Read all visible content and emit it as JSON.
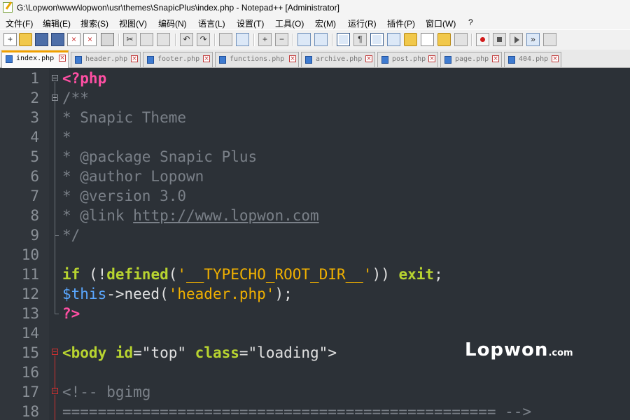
{
  "window": {
    "title": "G:\\Lopwon\\www\\lopwon\\usr\\themes\\SnapicPlus\\index.php - Notepad++ [Administrator]"
  },
  "menu": {
    "items": [
      {
        "label": "文件(F)"
      },
      {
        "label": "编辑(E)"
      },
      {
        "label": "搜索(S)"
      },
      {
        "label": "视图(V)"
      },
      {
        "label": "编码(N)"
      },
      {
        "label": "语言(L)"
      },
      {
        "label": "设置(T)"
      },
      {
        "label": "工具(O)"
      },
      {
        "label": "宏(M)"
      },
      {
        "label": "运行(R)"
      },
      {
        "label": "插件(P)"
      },
      {
        "label": "窗口(W)"
      },
      {
        "label": "?"
      }
    ]
  },
  "toolbar": {
    "icons": [
      "new-file-icon",
      "open-file-icon",
      "save-icon",
      "save-all-icon",
      "close-icon",
      "close-all-icon",
      "print-icon",
      "cut-icon",
      "copy-icon",
      "paste-icon",
      "undo-icon",
      "redo-icon",
      "find-icon",
      "replace-icon",
      "zoom-in-icon",
      "zoom-out-icon",
      "sync-v-icon",
      "sync-h-icon",
      "word-wrap-icon",
      "show-all-chars-icon",
      "indent-guide-icon",
      "udl-icon",
      "doc-map-icon",
      "function-list-icon",
      "folder-workspace-icon",
      "monitor-icon",
      "record-macro-icon",
      "stop-macro-icon",
      "play-macro-icon",
      "run-macro-icon",
      "save-macro-icon"
    ]
  },
  "tabs": [
    {
      "label": "index.php",
      "active": true
    },
    {
      "label": "header.php",
      "active": false
    },
    {
      "label": "footer.php",
      "active": false
    },
    {
      "label": "functions.php",
      "active": false
    },
    {
      "label": "archive.php",
      "active": false
    },
    {
      "label": "post.php",
      "active": false
    },
    {
      "label": "page.php",
      "active": false
    },
    {
      "label": "404.php",
      "active": false
    }
  ],
  "editor": {
    "lines": [
      {
        "n": "1",
        "tokens": [
          {
            "t": "<?php",
            "c": "c-tag"
          }
        ]
      },
      {
        "n": "2",
        "tokens": [
          {
            "t": "/**",
            "c": "c-comment"
          }
        ]
      },
      {
        "n": "3",
        "tokens": [
          {
            "t": "* Snapic Theme",
            "c": "c-comment"
          }
        ]
      },
      {
        "n": "4",
        "tokens": [
          {
            "t": "*",
            "c": "c-comment"
          }
        ]
      },
      {
        "n": "5",
        "tokens": [
          {
            "t": "* @package Snapic Plus",
            "c": "c-comment"
          }
        ]
      },
      {
        "n": "6",
        "tokens": [
          {
            "t": "* @author Lopown",
            "c": "c-comment"
          }
        ]
      },
      {
        "n": "7",
        "tokens": [
          {
            "t": "* @version 3.0",
            "c": "c-comment"
          }
        ]
      },
      {
        "n": "8",
        "tokens": [
          {
            "t": "* @link ",
            "c": "c-comment"
          },
          {
            "t": "http://www.lopwon.com",
            "c": "c-link"
          }
        ]
      },
      {
        "n": "9",
        "tokens": [
          {
            "t": "*/",
            "c": "c-comment"
          }
        ]
      },
      {
        "n": "10",
        "tokens": []
      },
      {
        "n": "11",
        "tokens": [
          {
            "t": "if",
            "c": "c-kw"
          },
          {
            "t": " (!",
            "c": "c-plain"
          },
          {
            "t": "defined",
            "c": "c-kw"
          },
          {
            "t": "(",
            "c": "c-plain"
          },
          {
            "t": "'__TYPECHO_ROOT_DIR__'",
            "c": "c-str"
          },
          {
            "t": ")) ",
            "c": "c-plain"
          },
          {
            "t": "exit",
            "c": "c-kw"
          },
          {
            "t": ";",
            "c": "c-plain"
          }
        ]
      },
      {
        "n": "12",
        "tokens": [
          {
            "t": "$this",
            "c": "c-var"
          },
          {
            "t": "->need(",
            "c": "c-plain"
          },
          {
            "t": "'header.php'",
            "c": "c-str"
          },
          {
            "t": ");",
            "c": "c-plain"
          }
        ]
      },
      {
        "n": "13",
        "tokens": [
          {
            "t": "?>",
            "c": "c-tag"
          }
        ]
      },
      {
        "n": "14",
        "tokens": []
      },
      {
        "n": "15",
        "tokens": [
          {
            "t": "<body ",
            "c": "c-htmltag"
          },
          {
            "t": "id",
            "c": "c-attr"
          },
          {
            "t": "=\"top\" ",
            "c": "c-attrval"
          },
          {
            "t": "class",
            "c": "c-attr"
          },
          {
            "t": "=\"loading\">",
            "c": "c-attrval"
          }
        ]
      },
      {
        "n": "16",
        "tokens": []
      },
      {
        "n": "17",
        "tokens": [
          {
            "t": "<!-- bgimg",
            "c": "c-comment"
          }
        ]
      },
      {
        "n": "18",
        "tokens": [
          {
            "t": "================================================= -->",
            "c": "c-comment"
          }
        ]
      }
    ]
  },
  "watermark": {
    "main": "Lopwon",
    "suffix": ".com"
  }
}
